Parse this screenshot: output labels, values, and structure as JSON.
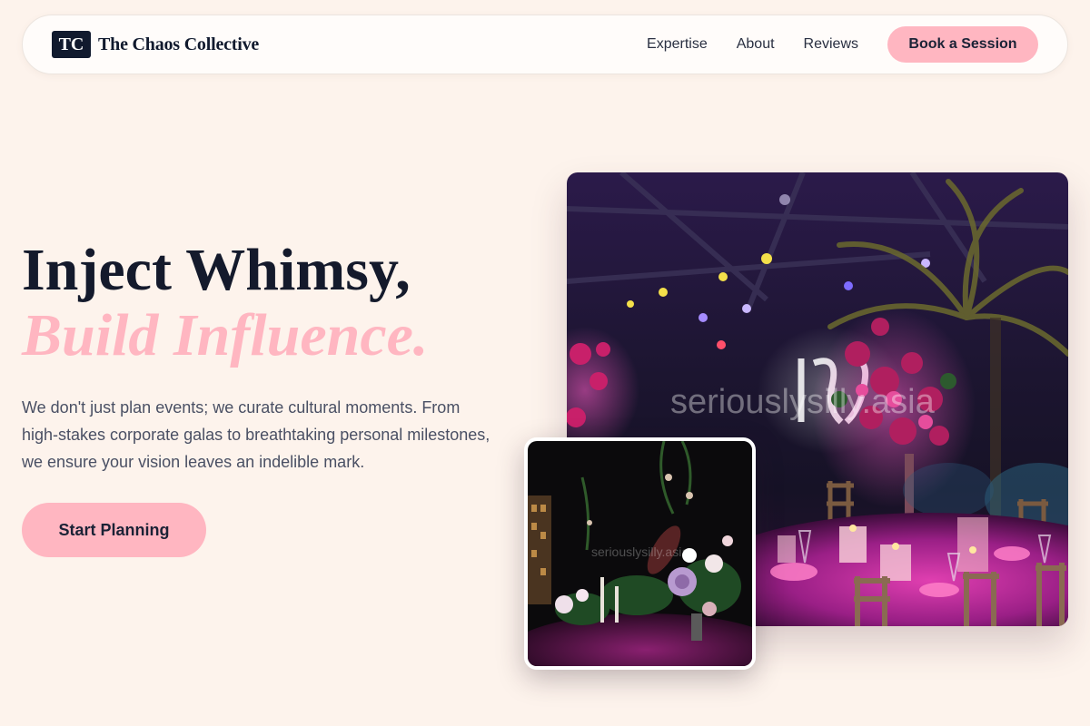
{
  "brand": {
    "mark": "TC",
    "name": "The Chaos Collective"
  },
  "nav": {
    "links": [
      "Expertise",
      "About",
      "Reviews"
    ],
    "cta_label": "Book a Session"
  },
  "hero": {
    "headline_line1": "Inject Whimsy,",
    "headline_line2": "Build Influence.",
    "lede": "We don't just plan events; we curate cultural moments. From high-stakes corporate galas to breathtaking personal milestones, we ensure your vision leaves an indelible mark.",
    "cta_label": "Start Planning"
  },
  "images": {
    "main_watermark": "seriouslysilly.asia",
    "small_watermark": "seriouslysilly.asia"
  },
  "colors": {
    "background": "#fdf3ec",
    "accent_pink": "#ffb6c1",
    "ink": "#141a2c",
    "brand_mark_bg": "#111a2e"
  }
}
